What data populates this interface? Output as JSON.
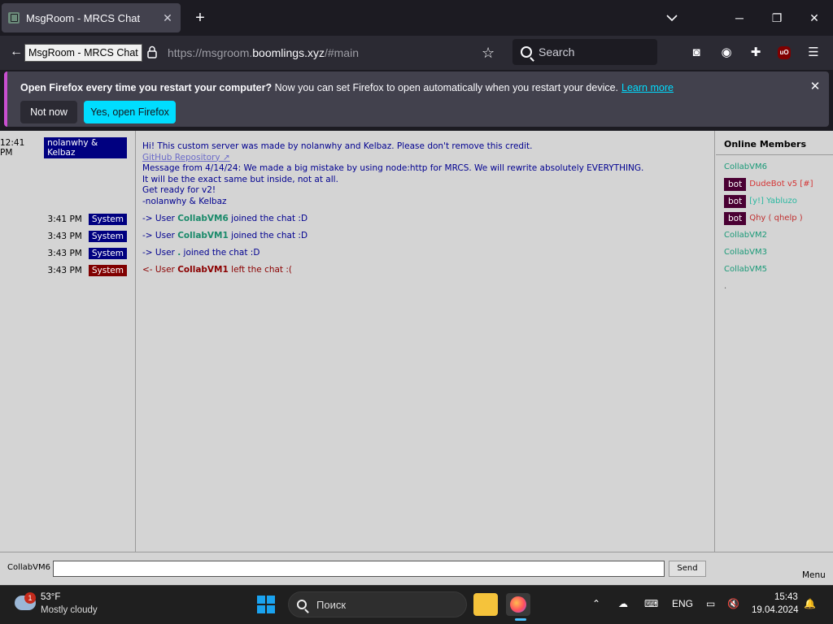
{
  "browser": {
    "tab_title": "MsgRoom - MRCS Chat",
    "tooltip": "MsgRoom - MRCS Chat",
    "url_prefix": "https://msgroom.",
    "url_host": "boomlings.xyz",
    "url_suffix": "/#main",
    "search_placeholder": "Search"
  },
  "notification": {
    "bold": "Open Firefox every time you restart your computer?",
    "text": " Now you can set Firefox to open automatically when you restart your device.",
    "link": "Learn more",
    "btn_no": "Not now",
    "btn_yes": "Yes, open Firefox"
  },
  "chat": {
    "messages": [
      {
        "time": "12:41 PM",
        "author": "nolanwhy & Kelbaz",
        "line1": "Hi! This custom server was made by nolanwhy and Kelbaz. Please don't remove this credit.",
        "link": "GitHub Repository ↗",
        "line3": "Message from 4/14/24: We made a big mistake by using node:http for MRCS. We will rewrite absolutely EVERYTHING.",
        "line4": "It will be the exact same but inside, not at all.",
        "line5": "Get ready for v2!",
        "line6": "-nolanwhy & Kelbaz"
      },
      {
        "time": "3:41 PM",
        "author": "System",
        "prefix": "-> User ",
        "user": "CollabVM6",
        "suffix": " joined the chat :D"
      },
      {
        "time": "3:43 PM",
        "author": "System",
        "prefix": "-> User ",
        "user": "CollabVM1",
        "suffix": " joined the chat :D"
      },
      {
        "time": "3:43 PM",
        "author": "System",
        "prefix": "-> User ",
        "user": ".",
        "suffix": " joined the chat :D"
      },
      {
        "time": "3:43 PM",
        "author": "System",
        "prefix": "<- User ",
        "user": "CollabVM1",
        "suffix": " left the chat :("
      }
    ]
  },
  "members": {
    "title": "Online Members",
    "list": [
      {
        "name": "CollabVM6",
        "bot": false
      },
      {
        "name": "DudeBot v5 [#]",
        "bot": true,
        "bot_label": "bot"
      },
      {
        "name": "[y!] Yabluzo",
        "bot": true,
        "bot_label": "bot"
      },
      {
        "name": "Qhy ( qhelp )",
        "bot": true,
        "bot_label": "bot"
      },
      {
        "name": "CollabVM2",
        "bot": false
      },
      {
        "name": "CollabVM3",
        "bot": false
      },
      {
        "name": "CollabVM5",
        "bot": false
      },
      {
        "name": ".",
        "bot": false
      }
    ]
  },
  "input": {
    "nickname": "CollabVM6",
    "value": "",
    "send_label": "Send",
    "menu_label": "Menu"
  },
  "taskbar": {
    "weather_badge": "1",
    "temp": "53°F",
    "weather": "Mostly cloudy",
    "search": "Поиск",
    "lang": "ENG",
    "time": "15:43",
    "date": "19.04.2024"
  }
}
